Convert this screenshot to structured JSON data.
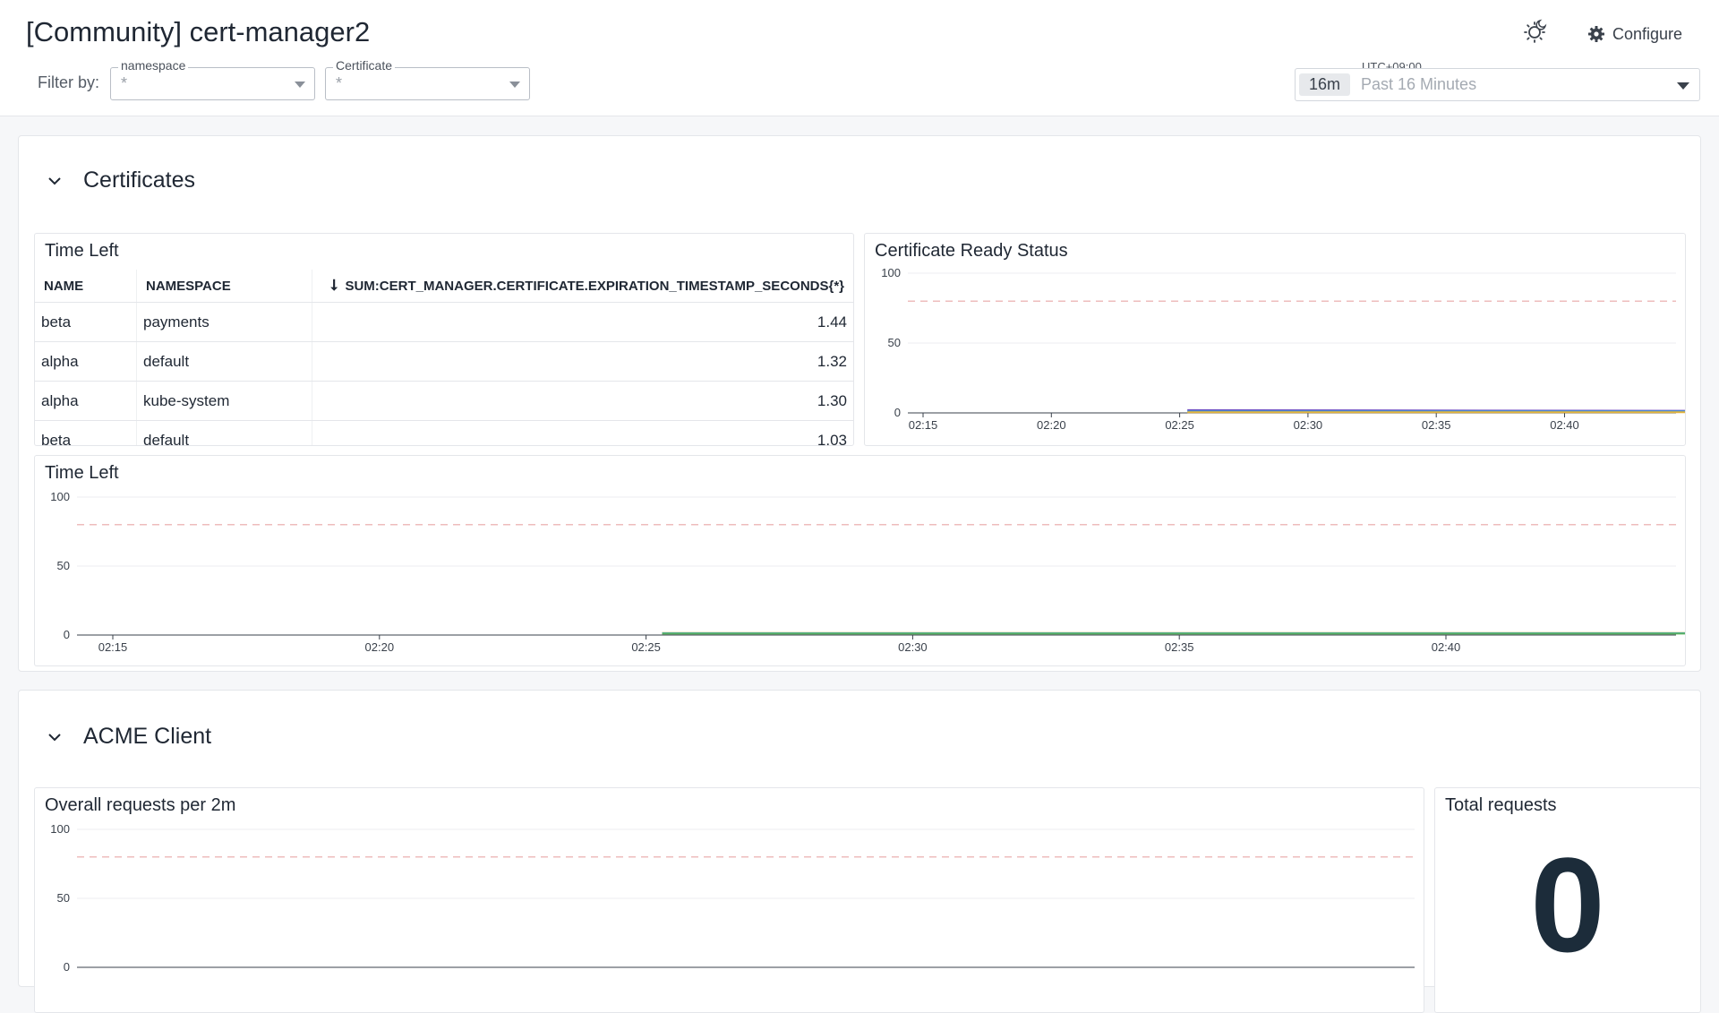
{
  "dashboard": {
    "title": "[Community] cert-manager2"
  },
  "filters": {
    "label": "Filter by:",
    "items": [
      {
        "label": "namespace",
        "value": "*"
      },
      {
        "label": "Certificate",
        "value": "*"
      }
    ]
  },
  "toolbar": {
    "configure_label": "Configure",
    "theme_icon": "theme-toggle-icon",
    "configure_icon": "gear-icon"
  },
  "timepicker": {
    "timezone": "UTC+09:00",
    "duration": "16m",
    "label": "Past 16 Minutes"
  },
  "groups": [
    {
      "title": "Certificates"
    },
    {
      "title": "ACME Client"
    }
  ],
  "widgets": {
    "time_left_table": {
      "title": "Time Left",
      "columns": [
        "NAME",
        "NAMESPACE",
        "SUM:CERT_MANAGER.CERTIFICATE.EXPIRATION_TIMESTAMP_SECONDS{*}"
      ],
      "rows": [
        [
          "beta",
          "payments",
          "1.44"
        ],
        [
          "alpha",
          "default",
          "1.32"
        ],
        [
          "alpha",
          "kube-system",
          "1.30"
        ],
        [
          "beta",
          "default",
          "1.03"
        ]
      ]
    },
    "ready_status": {
      "title": "Certificate Ready Status"
    },
    "time_left_chart": {
      "title": "Time Left"
    },
    "overall_requests": {
      "title": "Overall requests per 2m"
    },
    "total_requests": {
      "title": "Total requests",
      "value": "0"
    }
  },
  "chart_data": [
    {
      "type": "line",
      "title": "Certificate Ready Status",
      "x": [
        "02:15",
        "02:20",
        "02:25",
        "02:30",
        "02:35",
        "02:40"
      ],
      "ylim": [
        0,
        100
      ],
      "yticks": [
        0,
        50,
        100
      ],
      "threshold": 80,
      "grid": true,
      "series": [
        {
          "color": "#6d4fc4",
          "points": [
            [
              25.3,
              2
            ],
            [
              46.6,
              1.5
            ]
          ]
        },
        {
          "color": "#3ba4d8",
          "points": [
            [
              25.3,
              1
            ],
            [
              46.6,
              1
            ]
          ]
        },
        {
          "color": "#e3b23c",
          "points": [
            [
              25.3,
              0.5
            ],
            [
              46.6,
              0.5
            ]
          ]
        }
      ]
    },
    {
      "type": "line",
      "title": "Time Left",
      "x": [
        "02:15",
        "02:20",
        "02:25",
        "02:30",
        "02:35",
        "02:40"
      ],
      "ylim": [
        0,
        100
      ],
      "yticks": [
        0,
        50,
        100
      ],
      "threshold": 80,
      "grid": true,
      "series": [
        {
          "color": "#e3b23c",
          "points": [
            [
              25.3,
              1.44
            ],
            [
              46.6,
              1.44
            ]
          ]
        },
        {
          "color": "#6d4fc4",
          "points": [
            [
              25.3,
              1.32
            ],
            [
              46.6,
              1.32
            ]
          ]
        },
        {
          "color": "#3ba4d8",
          "points": [
            [
              25.3,
              1.3
            ],
            [
              46.6,
              1.3
            ]
          ]
        },
        {
          "color": "#5ab05e",
          "points": [
            [
              25.3,
              1.03
            ],
            [
              46.6,
              1.03
            ]
          ]
        }
      ]
    },
    {
      "type": "line",
      "title": "Overall requests per 2m",
      "ylim": [
        0,
        100
      ],
      "yticks": [
        0,
        50,
        100
      ],
      "threshold": 80,
      "grid": true,
      "series": []
    }
  ]
}
